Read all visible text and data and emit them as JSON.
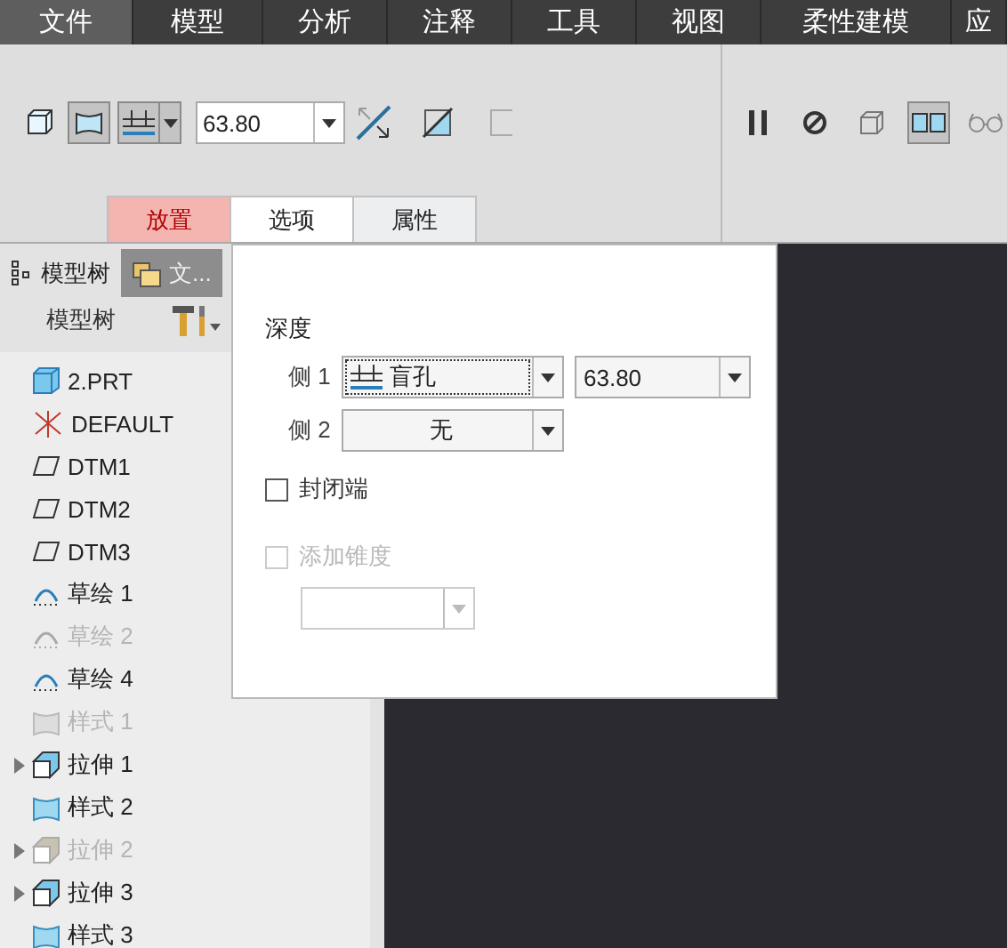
{
  "menu": [
    {
      "label": "文件",
      "selected": true
    },
    {
      "label": "模型",
      "selected": false
    },
    {
      "label": "分析",
      "selected": false
    },
    {
      "label": "注释",
      "selected": false
    },
    {
      "label": "工具",
      "selected": false
    },
    {
      "label": "视图",
      "selected": false
    },
    {
      "label": "柔性建模",
      "selected": false
    },
    {
      "label": "应",
      "selected": false
    }
  ],
  "ribbon": {
    "tools": [
      {
        "kind": "solid",
        "selected": false
      },
      {
        "kind": "surface",
        "selected": true
      },
      {
        "kind": "depth",
        "selected": true
      }
    ],
    "depth_value": "63.80",
    "right_tools": [
      {
        "kind": "pause",
        "selected": false
      },
      {
        "kind": "stop",
        "selected": false
      },
      {
        "kind": "preview",
        "selected": false
      },
      {
        "kind": "verify",
        "selected": true
      },
      {
        "kind": "glasses",
        "selected": false
      }
    ],
    "tabs": [
      {
        "label": "放置",
        "selected": false,
        "warning": true
      },
      {
        "label": "选项",
        "selected": true,
        "warning": false
      },
      {
        "label": "属性",
        "selected": false,
        "warning": false
      }
    ]
  },
  "panel_tabs": [
    {
      "label": "模型树",
      "selected": true
    },
    {
      "label": "文...",
      "selected": false
    }
  ],
  "tree_header": "模型树",
  "tree": [
    {
      "label": "2.PRT",
      "kind": "part",
      "disabled": false,
      "has_children": false
    },
    {
      "label": "DEFAULT",
      "kind": "csys",
      "disabled": false,
      "has_children": false
    },
    {
      "label": "DTM1",
      "kind": "plane",
      "disabled": false,
      "has_children": false
    },
    {
      "label": "DTM2",
      "kind": "plane",
      "disabled": false,
      "has_children": false
    },
    {
      "label": "DTM3",
      "kind": "plane",
      "disabled": false,
      "has_children": false
    },
    {
      "label": "草绘 1",
      "kind": "sketch",
      "disabled": false,
      "has_children": false
    },
    {
      "label": "草绘 2",
      "kind": "sketch",
      "disabled": true,
      "has_children": false
    },
    {
      "label": "草绘 4",
      "kind": "sketch",
      "disabled": false,
      "has_children": false
    },
    {
      "label": "样式 1",
      "kind": "style",
      "disabled": true,
      "has_children": false
    },
    {
      "label": "拉伸 1",
      "kind": "extrude",
      "disabled": false,
      "has_children": true
    },
    {
      "label": "样式 2",
      "kind": "style",
      "disabled": false,
      "has_children": false
    },
    {
      "label": "拉伸 2",
      "kind": "extrude",
      "disabled": true,
      "has_children": true
    },
    {
      "label": "拉伸 3",
      "kind": "extrude",
      "disabled": false,
      "has_children": true
    },
    {
      "label": "样式 3",
      "kind": "style",
      "disabled": false,
      "has_children": false
    }
  ],
  "options": {
    "title": "深度",
    "sides": [
      {
        "label": "侧 1",
        "type": "盲孔",
        "value": "63.80"
      },
      {
        "label": "侧 2",
        "type": "无"
      }
    ],
    "checks": [
      {
        "label": "封闭端",
        "checked": false,
        "disabled": false
      },
      {
        "label": "添加锥度",
        "checked": false,
        "disabled": true
      }
    ]
  }
}
